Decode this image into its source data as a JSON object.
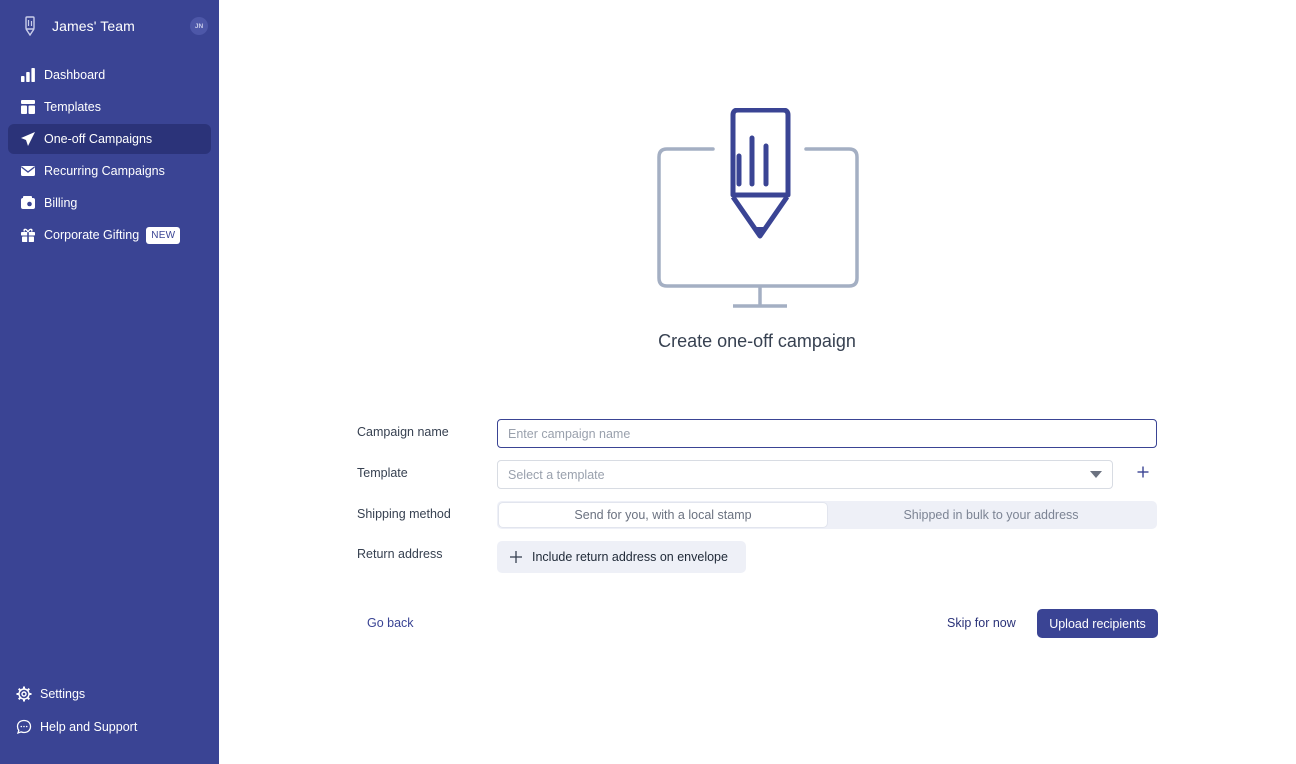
{
  "sidebar": {
    "team_name": "James' Team",
    "avatar_initials": "JN",
    "items": [
      {
        "label": "Dashboard",
        "icon": "bar-chart-icon"
      },
      {
        "label": "Templates",
        "icon": "layout-icon"
      },
      {
        "label": "One-off Campaigns",
        "icon": "paper-plane-icon",
        "active": true
      },
      {
        "label": "Recurring Campaigns",
        "icon": "envelope-icon"
      },
      {
        "label": "Billing",
        "icon": "wallet-icon"
      },
      {
        "label": "Corporate Gifting",
        "icon": "gift-icon",
        "badge": "NEW"
      }
    ],
    "bottom_items": [
      {
        "label": "Settings",
        "icon": "gear-icon"
      },
      {
        "label": "Help and Support",
        "icon": "chat-bubble-icon"
      }
    ],
    "bg_color": "#3a4494",
    "active_color": "#2b3379"
  },
  "main": {
    "title": "Create one-off campaign",
    "form": {
      "campaign_name_label": "Campaign name",
      "campaign_name_placeholder": "Enter campaign name",
      "campaign_name_value": "",
      "template_label": "Template",
      "template_placeholder": "Select a template",
      "shipping_label": "Shipping method",
      "shipping_options": [
        "Send for you, with a local stamp",
        "Shipped in bulk to your address"
      ],
      "shipping_selected": "Send for you, with a local stamp",
      "return_label": "Return address",
      "return_button": "Include return address on envelope"
    },
    "actions": {
      "back": "Go back",
      "skip": "Skip for now",
      "upload": "Upload recipients"
    }
  }
}
